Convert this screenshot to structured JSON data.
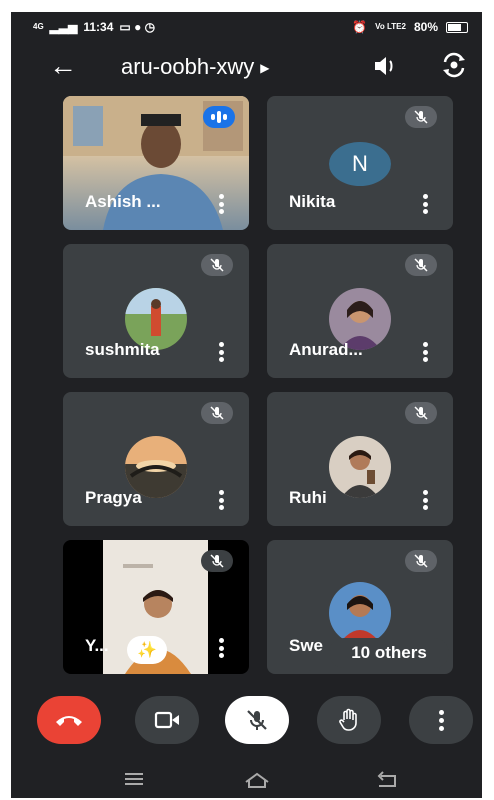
{
  "status_bar": {
    "network": "4G",
    "time": "11:34",
    "volte": "Vo LTE2",
    "battery": "80%"
  },
  "app_bar": {
    "meeting_code": "aru-oobh-xwy"
  },
  "participants": [
    {
      "name": "Ashish ...",
      "state": "speaking",
      "video": true
    },
    {
      "name": "Nikita",
      "initial": "N",
      "muted": true
    },
    {
      "name": "sushmita",
      "muted": true
    },
    {
      "name": "Anurad...",
      "muted": true
    },
    {
      "name": "Pragya",
      "muted": true
    },
    {
      "name": "Ruhi",
      "muted": true
    },
    {
      "name": "Y...",
      "muted": true,
      "video": true
    },
    {
      "name": "Swe",
      "muted": true
    }
  ],
  "others_label": "10 others",
  "controls": [
    "end-call",
    "camera",
    "microphone-muted",
    "raise-hand",
    "more-options"
  ],
  "colors": {
    "background": "#202124",
    "tile": "#3c4043",
    "end_call": "#ea4335",
    "speaking": "#1a73e8"
  }
}
